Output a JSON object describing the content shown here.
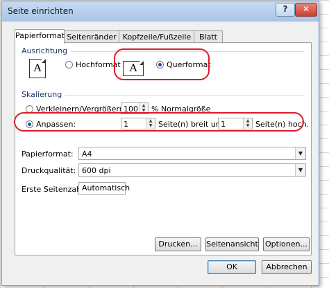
{
  "window": {
    "title": "Seite einrichten",
    "help_label": "?",
    "close_label": "✕"
  },
  "tabs": [
    {
      "label": "Papierformat",
      "active": true
    },
    {
      "label": "Seitenränder",
      "active": false
    },
    {
      "label": "Kopfzeile/Fußzeile",
      "active": false
    },
    {
      "label": "Blatt",
      "active": false
    }
  ],
  "orientation": {
    "group_label": "Ausrichtung",
    "portrait_label": "Hochformat",
    "landscape_label": "Querformat",
    "portrait_icon_letter": "A",
    "landscape_icon_letter": "A",
    "selected": "landscape"
  },
  "scaling": {
    "group_label": "Skalierung",
    "adjust_to_label": "Verkleinern/Vergrößern:",
    "adjust_to_value": "100",
    "adjust_to_suffix": "% Normalgröße",
    "fit_to_label": "Anpassen:",
    "fit_wide_value": "1",
    "fit_wide_suffix": "Seite(n) breit und",
    "fit_tall_value": "1",
    "fit_tall_suffix": "Seite(n) hoch.",
    "selected": "fit_to"
  },
  "paper": {
    "paper_size_label": "Papierformat:",
    "paper_size_value": "A4",
    "print_quality_label": "Druckqualität:",
    "print_quality_value": "600 dpi",
    "first_page_label": "Erste Seitenzahl:",
    "first_page_value": "Automatisch"
  },
  "actions": {
    "print_label": "Drucken...",
    "preview_label": "Seitenansicht",
    "options_label": "Optionen...",
    "ok_label": "OK",
    "cancel_label": "Abbrechen"
  },
  "colors": {
    "highlight": "#d91b2a",
    "titlebar": "#b6d0ee"
  }
}
